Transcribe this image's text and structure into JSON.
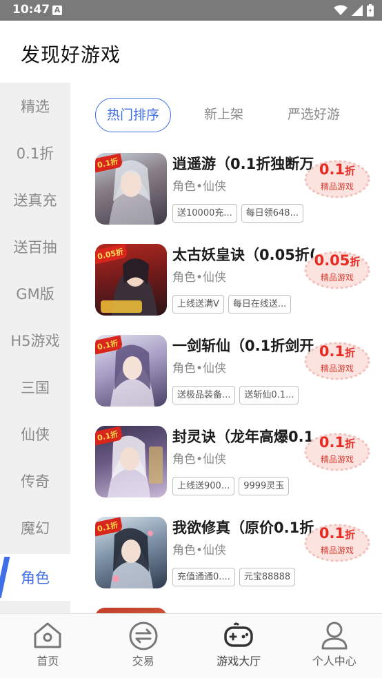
{
  "status_bar": {
    "time": "10:47",
    "notification_letter": "A"
  },
  "header": {
    "title": "发现好游戏"
  },
  "sidebar": {
    "items": [
      {
        "label": "精选"
      },
      {
        "label": "0.1折"
      },
      {
        "label": "送真充"
      },
      {
        "label": "送百抽"
      },
      {
        "label": "GM版"
      },
      {
        "label": "H5游戏"
      },
      {
        "label": "三国"
      },
      {
        "label": "仙侠"
      },
      {
        "label": "传奇"
      },
      {
        "label": "魔幻"
      },
      {
        "label": "角色"
      }
    ],
    "active_index": 10
  },
  "tabs": [
    {
      "label": "热门排序",
      "active": true
    },
    {
      "label": "新上架",
      "active": false
    },
    {
      "label": "严选好游",
      "active": false
    }
  ],
  "games": [
    {
      "name": "逍遥游（0.1折独断万",
      "category": "角色•仙侠",
      "badge": "0.1折",
      "discount_value": "0.1",
      "discount_unit": "折",
      "discount_sub": "精品游戏",
      "tags": [
        "送10000充...",
        "每日领648..."
      ]
    },
    {
      "name": "太古妖皇诀（0.05折(",
      "category": "角色•仙侠",
      "badge": "0.05折",
      "discount_value": "0.05",
      "discount_unit": "折",
      "discount_sub": "精品游戏",
      "tags": [
        "上线送满V",
        "每日在线送..."
      ]
    },
    {
      "name": "一剑斩仙（0.1折剑开",
      "category": "角色•仙侠",
      "badge": "0.1折",
      "discount_value": "0.1",
      "discount_unit": "折",
      "discount_sub": "精品游戏",
      "tags": [
        "送极品装备...",
        "送斩仙0.1..."
      ]
    },
    {
      "name": "封灵诀（龙年高爆0.1",
      "category": "角色•仙侠",
      "badge": "0.1折",
      "discount_value": "0.1",
      "discount_unit": "折",
      "discount_sub": "精品游戏",
      "tags": [
        "上线送900...",
        "9999灵玉"
      ]
    },
    {
      "name": "我欲修真（原价0.1折",
      "category": "角色•仙侠",
      "badge": "0.1折",
      "discount_value": "0.1",
      "discount_unit": "折",
      "discount_sub": "精品游戏",
      "tags": [
        "充值通通0....",
        "元宝88888"
      ]
    }
  ],
  "bottom_nav": [
    {
      "label": "首页",
      "icon": "home-icon"
    },
    {
      "label": "交易",
      "icon": "trade-icon"
    },
    {
      "label": "游戏大厅",
      "icon": "gamepad-icon",
      "active": true
    },
    {
      "label": "个人中心",
      "icon": "profile-icon"
    }
  ],
  "colors": {
    "accent": "#3e6fe6",
    "discount": "#e62b22",
    "status_bar": "#7a7a7a",
    "sidebar_bg": "#f0f0f0"
  }
}
